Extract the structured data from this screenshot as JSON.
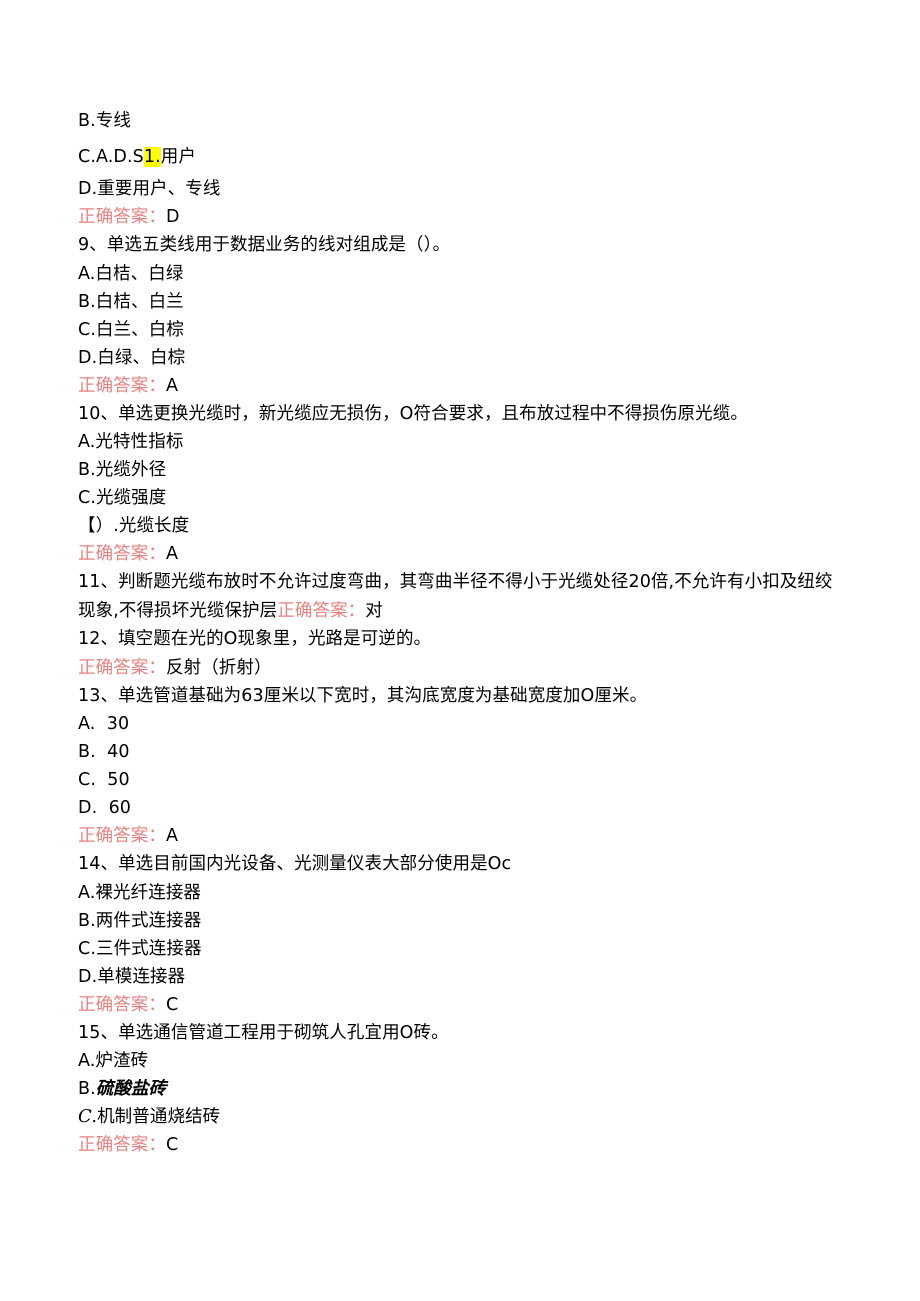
{
  "document": {
    "type": "exam-question-bank",
    "language": "zh-CN",
    "answer_label": "正确答案：",
    "colors": {
      "text": "#000000",
      "answer_label": "#e8827f",
      "highlight": "#ffff00",
      "background": "#ffffff"
    }
  },
  "carryover": {
    "option_b": "B.专线",
    "option_c_prefix": "C.A.D.S",
    "option_c_highlight": "1.",
    "option_c_suffix": "用户",
    "option_d": "D.重要用户、专线",
    "answer_label": "正确答案：",
    "answer_value": "D"
  },
  "questions": [
    {
      "number": "9",
      "stem": "9、单选五类线用于数据业务的线对组成是（）。",
      "options": [
        "A.白桔、白绿",
        "B.白桔、白兰",
        "C.白兰、白棕",
        "D.白绿、白棕"
      ],
      "answer_label": "正确答案：",
      "answer_value": "A"
    },
    {
      "number": "10",
      "stem": "10、单选更换光缆时，新光缆应无损伤，O符合要求，且布放过程中不得损伤原光缆。",
      "options": [
        "A.光特性指标",
        "B.光缆外径",
        "C.光缆强度",
        "【）.光缆长度"
      ],
      "answer_label": "正确答案：",
      "answer_value": "A"
    },
    {
      "number": "11",
      "stem": "11、判断题光缆布放时不允许过度弯曲，其弯曲半径不得小于光缆处径20倍,不允许有小扣及纽绞现象,不得损坏光缆保护层",
      "options": [],
      "inline_answer": true,
      "answer_label": "正确答案：",
      "answer_value": "对"
    },
    {
      "number": "12",
      "stem": "12、填空题在光的O现象里，光路是可逆的。",
      "options": [],
      "answer_label": "正确答案：",
      "answer_value": "反射（折射）"
    },
    {
      "number": "13",
      "stem": "13、单选管道基础为63厘米以下宽时，其沟底宽度为基础宽度加O厘米。",
      "options": [
        "A.  30",
        "B.  40",
        "C.  50",
        "D.  60"
      ],
      "answer_label": "正确答案：",
      "answer_value": "A"
    },
    {
      "number": "14",
      "stem": "14、单选目前国内光设备、光测量仪表大部分使用是Oc",
      "options": [
        "A.裸光纤连接器",
        "B.两件式连接器",
        "C.三件式连接器",
        "D.单模连接器"
      ],
      "answer_label": "正确答案：",
      "answer_value": "C"
    },
    {
      "number": "15",
      "stem": "15、单选通信管道工程用于砌筑人孔宜用O砖。",
      "options": [
        "A.炉渣砖"
      ],
      "option_b_label": "B.",
      "option_b_text": "硫酸盐砖",
      "option_c_label": "C.",
      "option_c_text": "机制普通烧结砖",
      "answer_label": "正确答案：",
      "answer_value": "C"
    }
  ]
}
